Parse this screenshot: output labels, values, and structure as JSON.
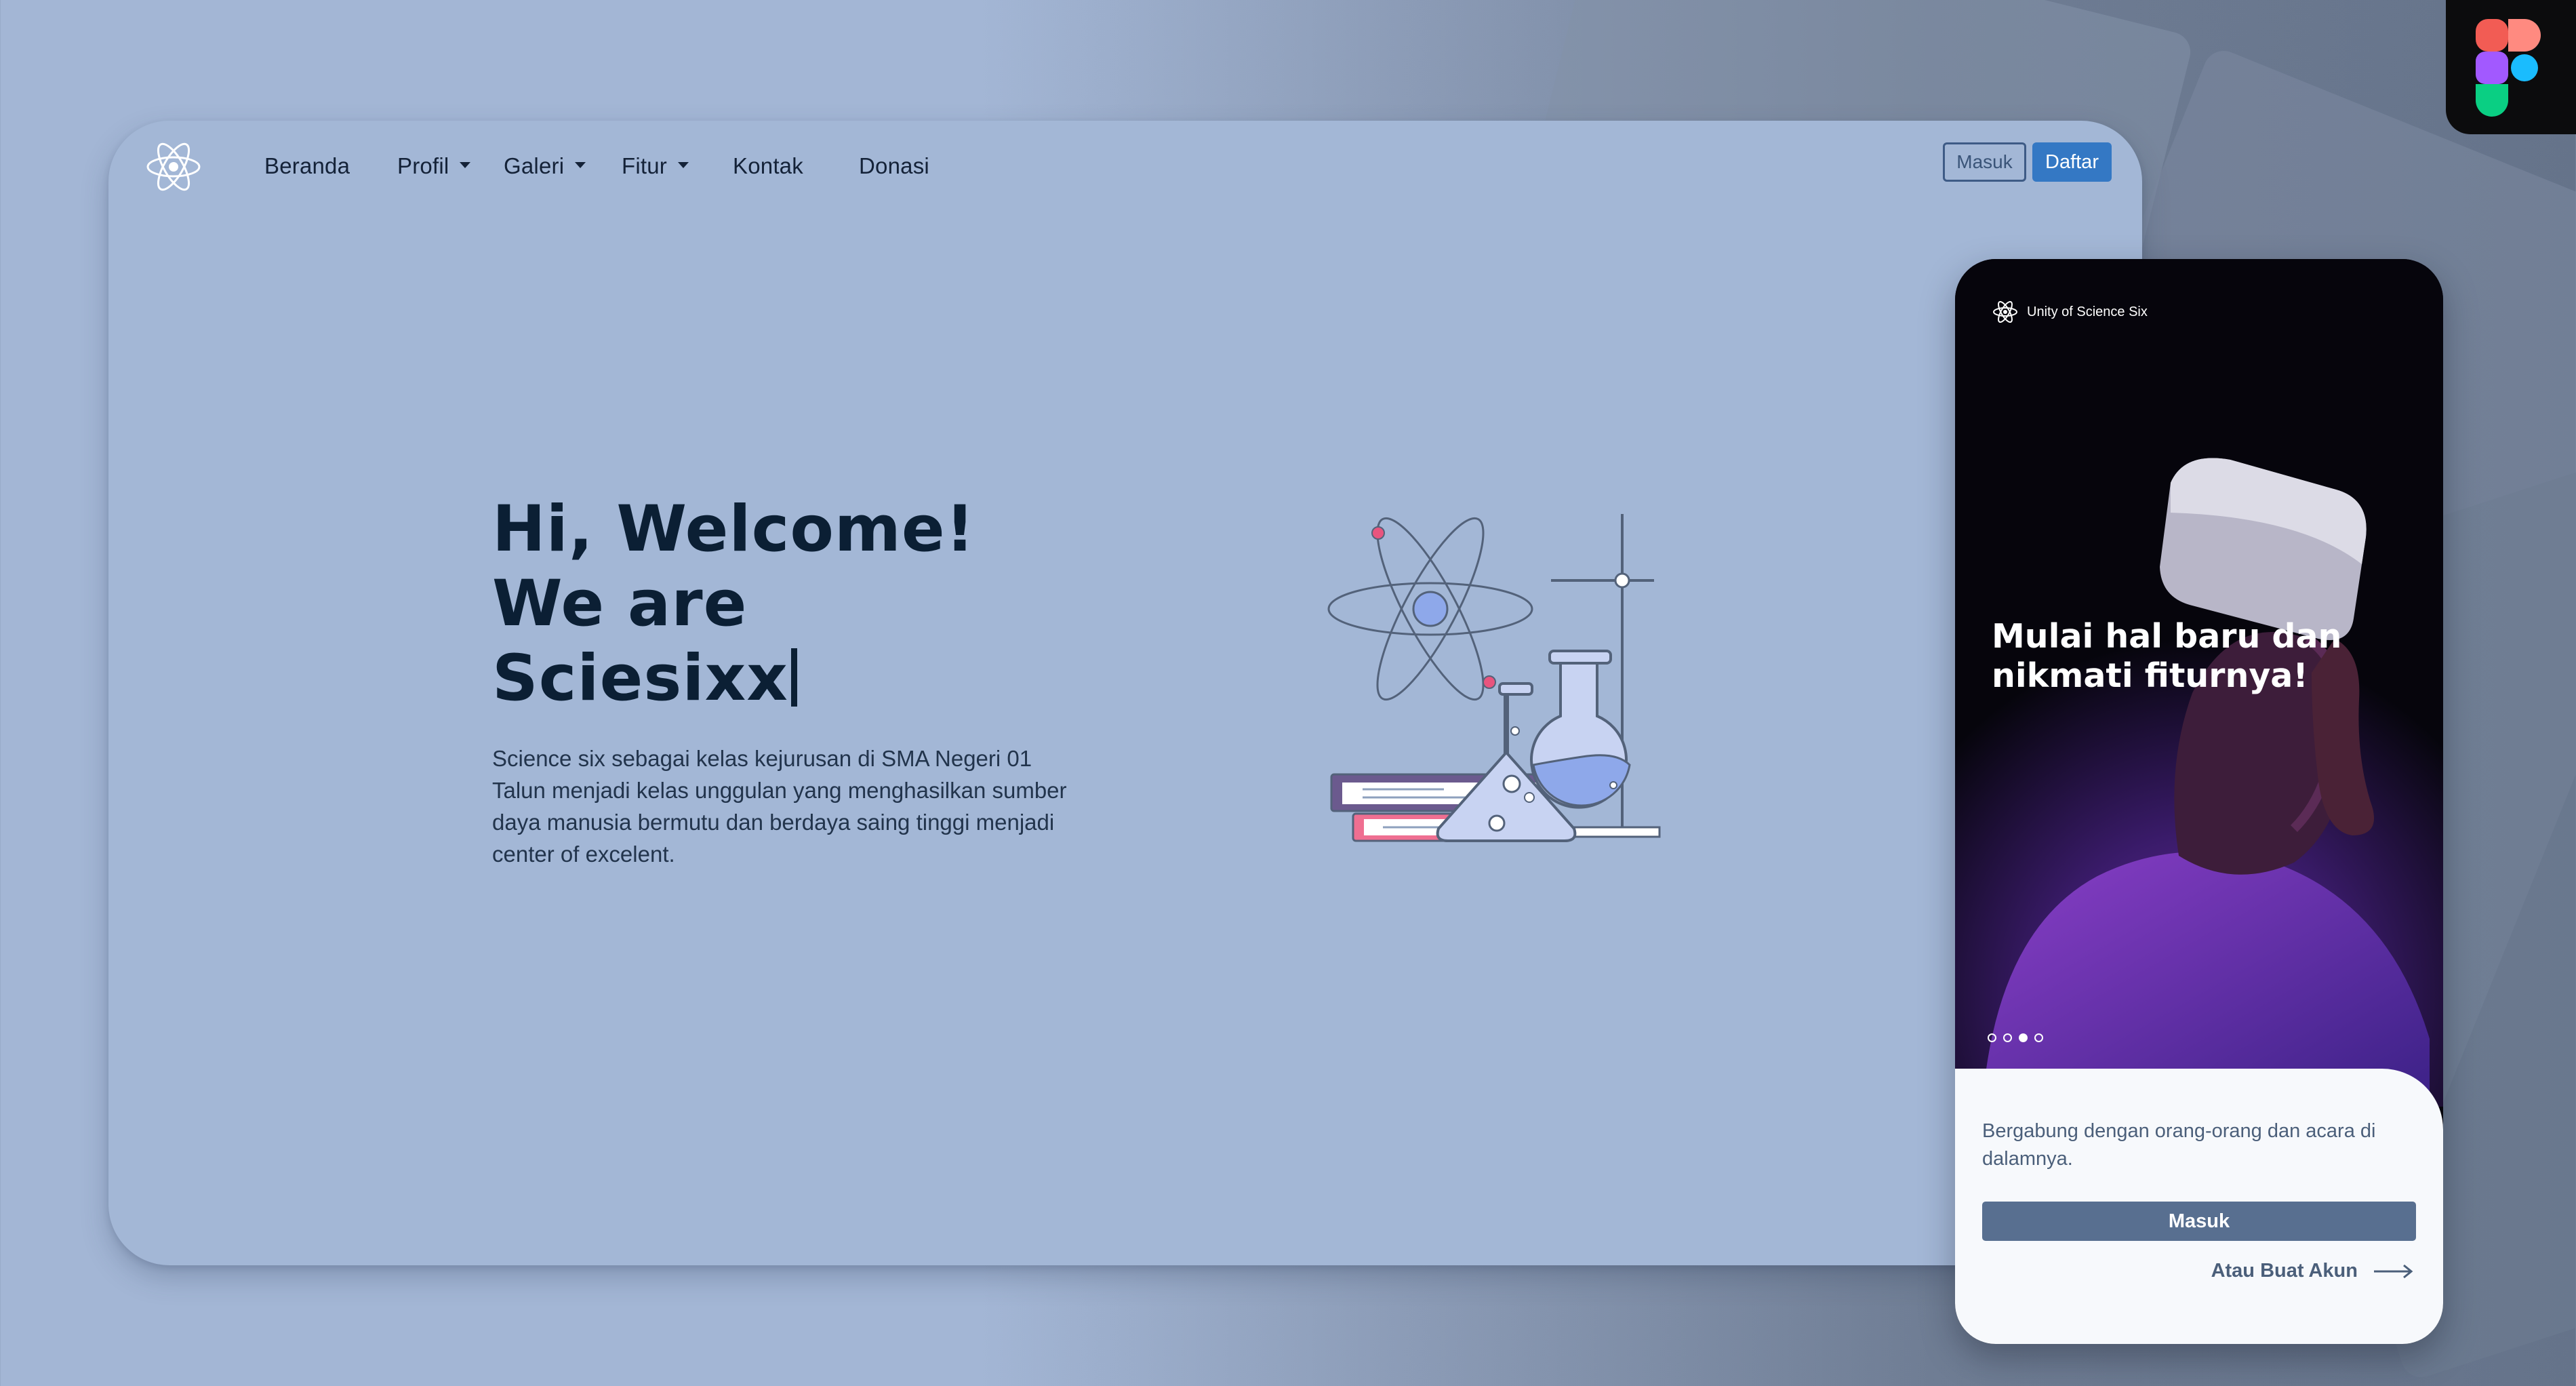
{
  "desktop": {
    "nav": {
      "items": [
        {
          "label": "Beranda",
          "dropdown": false
        },
        {
          "label": "Profil",
          "dropdown": true
        },
        {
          "label": "Galeri",
          "dropdown": true
        },
        {
          "label": "Fitur",
          "dropdown": true
        },
        {
          "label": "Kontak",
          "dropdown": false
        },
        {
          "label": "Donasi",
          "dropdown": false
        }
      ],
      "login_label": "Masuk",
      "register_label": "Daftar"
    },
    "hero": {
      "title_line1": "Hi, Welcome!",
      "title_line2": "We are",
      "title_line3": "Sciesixx",
      "description": "Science six sebagai kelas kejurusan di SMA Negeri 01 Talun menjadi kelas unggulan yang menghasilkan sumber daya manusia bermutu dan berdaya saing tinggi menjadi center of excelent."
    }
  },
  "mobile": {
    "brand": "Unity of Science Six",
    "headline": "Mulai hal baru dan nikmati fiturnya!",
    "carousel": {
      "total": 4,
      "active": 3
    },
    "sheet": {
      "text": "Bergabung dengan orang-orang dan acara di dalamnya.",
      "login_button": "Masuk",
      "create_account_link": "Atau Buat Akun"
    }
  },
  "colors": {
    "background": "#a3b6d5",
    "desktop_card": "#a3b7d6",
    "title_text": "#0b1f34",
    "daftar_button": "#3478c4",
    "mobile_button": "#586f90"
  },
  "icons": [
    "atom-logo-icon",
    "chevron-down-icon",
    "figma-logo-icon",
    "arrow-right-icon",
    "science-lab-illustration"
  ]
}
